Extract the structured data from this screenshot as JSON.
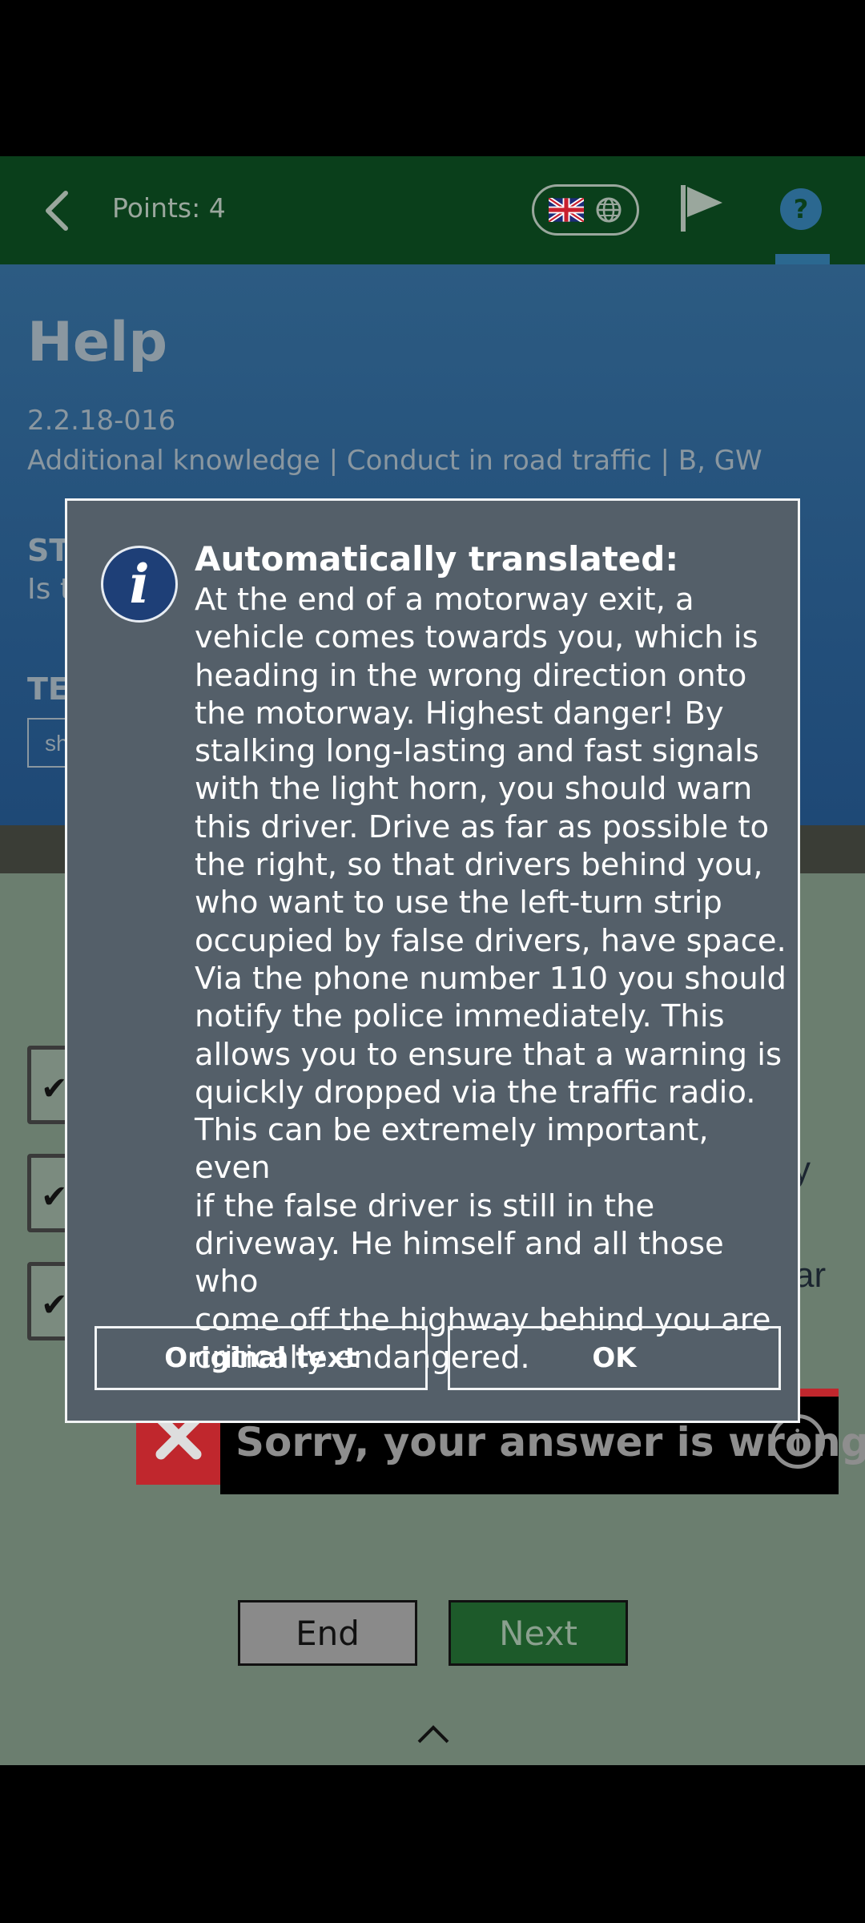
{
  "header": {
    "points_text": "Points: 4"
  },
  "help": {
    "title": "Help",
    "question_id": "2.2.18-016",
    "path": "Additional knowledge | Conduct in road traffic | B, GW",
    "partial_st": "ST",
    "partial_is": "Is t",
    "partial_te": "TE",
    "partial_box": "sh"
  },
  "answers": {
    "tail_1": "y",
    "tail_2": "ar"
  },
  "feedback": {
    "wrong_text": "Sorry, your answer is wrong"
  },
  "buttons": {
    "end": "End",
    "next": "Next"
  },
  "dialog": {
    "title": "Automatically translated:",
    "body": "At the end of a motorway exit, a\nvehicle comes towards you, which is\nheading in the wrong direction onto\nthe motorway. Highest danger! By\nstalking long-lasting and fast signals\nwith the light horn, you should warn\nthis driver. Drive as far as possible to\nthe right, so that drivers behind you,\nwho want to use the left-turn strip\noccupied by false drivers, have space.\nVia the phone number 110 you should\nnotify the police immediately. This\nallows you to ensure that a warning is\nquickly dropped via the traffic radio.\nThis can be extremely important, even\nif the false driver is still in the\ndriveway. He himself and all those who\ncome off the highway behind you are\ncritically endangered.",
    "original_text_button": "Original text",
    "ok_button": "OK"
  },
  "icons": {
    "back": "chevron-left-icon",
    "flag": "uk-flag-icon",
    "globe": "globe-icon",
    "report": "flag-icon",
    "help": "question-circle-icon",
    "info": "info-icon",
    "wrong": "x-icon",
    "expand": "chevron-up-icon"
  },
  "colors": {
    "header_bg": "#0a3f1b",
    "help_bg": "#2c5b82",
    "dialog_bg": "#545f69",
    "question_bg": "#6b7e6f",
    "wrong_red": "#c0272d",
    "next_green": "#1d5a2a"
  }
}
